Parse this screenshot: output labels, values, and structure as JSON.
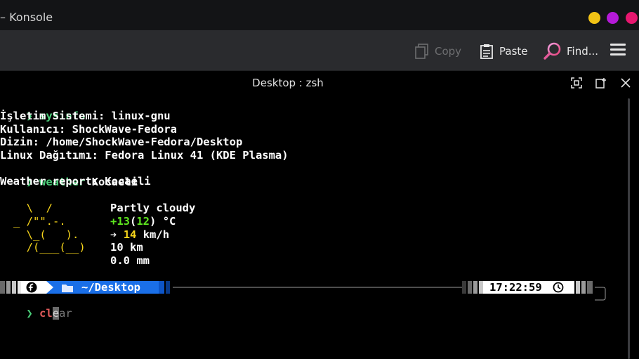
{
  "window": {
    "title": "– Konsole",
    "buttons": [
      "minimize",
      "maximize",
      "close"
    ],
    "button_colors": {
      "minimize": "#f2c315",
      "maximize": "#b51ad8",
      "close": "#e7176f"
    }
  },
  "toolbar": {
    "copy_label": "Copy",
    "paste_label": "Paste",
    "find_label": "Find...",
    "icons": {
      "copy": "copy-icon",
      "paste": "paste-icon",
      "find": "find-icon",
      "menu": "hamburger-menu-icon"
    }
  },
  "tab": {
    "title": "Desktop : zsh",
    "icons": [
      "fullscreen-icon",
      "new-tab-icon",
      "close-icon"
    ]
  },
  "terminal": {
    "prompt_symbol": "❯",
    "cmd1": "sysinfo",
    "sysinfo_lines": [
      "İşletim Sistemi: linux-gnu",
      "Kullanıcı: ShockWave-Fedora",
      "Dizin: /home/ShockWave-Fedora/Desktop",
      "Linux Dağıtımı: Fedora Linux 41 (KDE Plasma)"
    ],
    "cmd2": "weather",
    "cmd2_arg": "Kocaeli",
    "weather_header": "Weather report: Kocaeli",
    "weather_art": [
      "  \\  /",
      "_ /\"\".-.",
      "  \\_(   ).",
      "  /(___(__)"
    ],
    "weather_condition": "Partly cloudy",
    "temp_current": "+13",
    "temp_feels": "12",
    "temp_unit": "°C",
    "wind_arrow": "➔",
    "wind_speed": "14",
    "wind_unit": "km/h",
    "visibility": "10 km",
    "precipitation": "0.0 mm",
    "prompt": {
      "os_icon": "fedora-icon",
      "folder_icon": "folder-icon",
      "path": "~/Desktop",
      "time": "17:22:59",
      "clock_icon": "clock-icon"
    },
    "current_input_typed": "cl",
    "current_input_cursor": "e",
    "current_input_suggest": "ar"
  },
  "colors": {
    "prompt_green": "#4bd07a",
    "path_blue": "#1a6fe8",
    "sun_yellow": "#f7d51b",
    "temp_green": "#5ee61f"
  }
}
